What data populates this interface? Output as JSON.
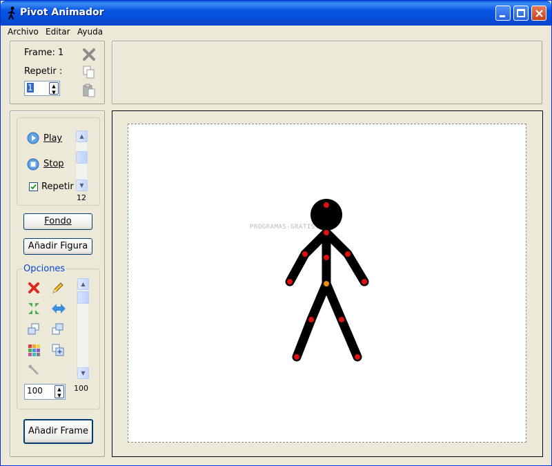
{
  "window": {
    "title": "Pivot Animador"
  },
  "menu": {
    "items": [
      "Archivo",
      "Editar",
      "Ayuda"
    ]
  },
  "frame_panel": {
    "frame_label": "Frame: 1",
    "repeat_label": "Repetir :",
    "repeat_value": "1"
  },
  "playback": {
    "play_label": "Play",
    "stop_label": "Stop",
    "repeat_checkbox_label": "Repetir",
    "repeat_checked": true,
    "speed_value": "12"
  },
  "buttons": {
    "background": "Fondo",
    "add_figure": "Añadir Figura",
    "add_frame": "Añadir Frame"
  },
  "options": {
    "group_label": "Opciones",
    "size_value": "100",
    "scale_value": "100"
  },
  "canvas": {
    "watermark": "PROGRAMAS-GRATIS.net"
  },
  "colors": {
    "title_bar": "#0A5FE0",
    "joint_red": "#E01010",
    "joint_orange": "#F08C10",
    "figure": "#000000",
    "group_label_blue": "#0046D5"
  },
  "icons": {
    "app": "stickman-icon",
    "delete": "close-icon",
    "copy": "copy-icon",
    "paste": "paste-icon",
    "play": "play-icon",
    "stop": "stop-icon",
    "options_delete": "delete-x-icon",
    "edit": "pencil-icon",
    "shrink": "shrink-arrows-icon",
    "flip": "flip-arrow-icon",
    "bring_front": "bring-to-front-icon",
    "send_back": "send-to-back-icon",
    "color": "color-palette-icon",
    "duplicate": "duplicate-icon",
    "tool": "wrench-icon"
  }
}
